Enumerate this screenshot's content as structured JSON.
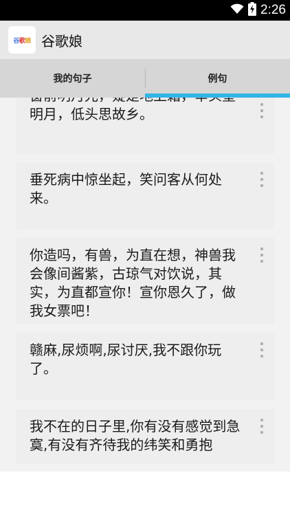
{
  "status_bar": {
    "time": "2:26",
    "icons": [
      "wifi-icon",
      "battery-icon"
    ]
  },
  "app_bar": {
    "logo_chars": [
      "谷",
      "歌",
      "娘"
    ],
    "logo_colors": [
      "#3b6fd8",
      "#d83b3b",
      "#e0a020"
    ],
    "title": "谷歌娘"
  },
  "tabs": [
    {
      "label": "我的句子",
      "selected": false
    },
    {
      "label": "例句",
      "selected": true
    }
  ],
  "accent_color": "#33b5e5",
  "sentences": [
    {
      "text": "窗前明月光，疑是地上霜，举头望明月，低头思故乡。"
    },
    {
      "text": "垂死病中惊坐起，笑问客从何处来。"
    },
    {
      "text": "你造吗，有兽，为直在想，神兽我会像间酱紫，古琼气对饮说，其实，为直都宣你！宣你恩久了，做我女票吧！"
    },
    {
      "text": "赣麻,尿烦啊,尿讨厌,我不跟你玩了。"
    },
    {
      "text": "我不在的日子里,你有没有感觉到急寞,有没有齐待我的纬笑和勇抱"
    }
  ]
}
